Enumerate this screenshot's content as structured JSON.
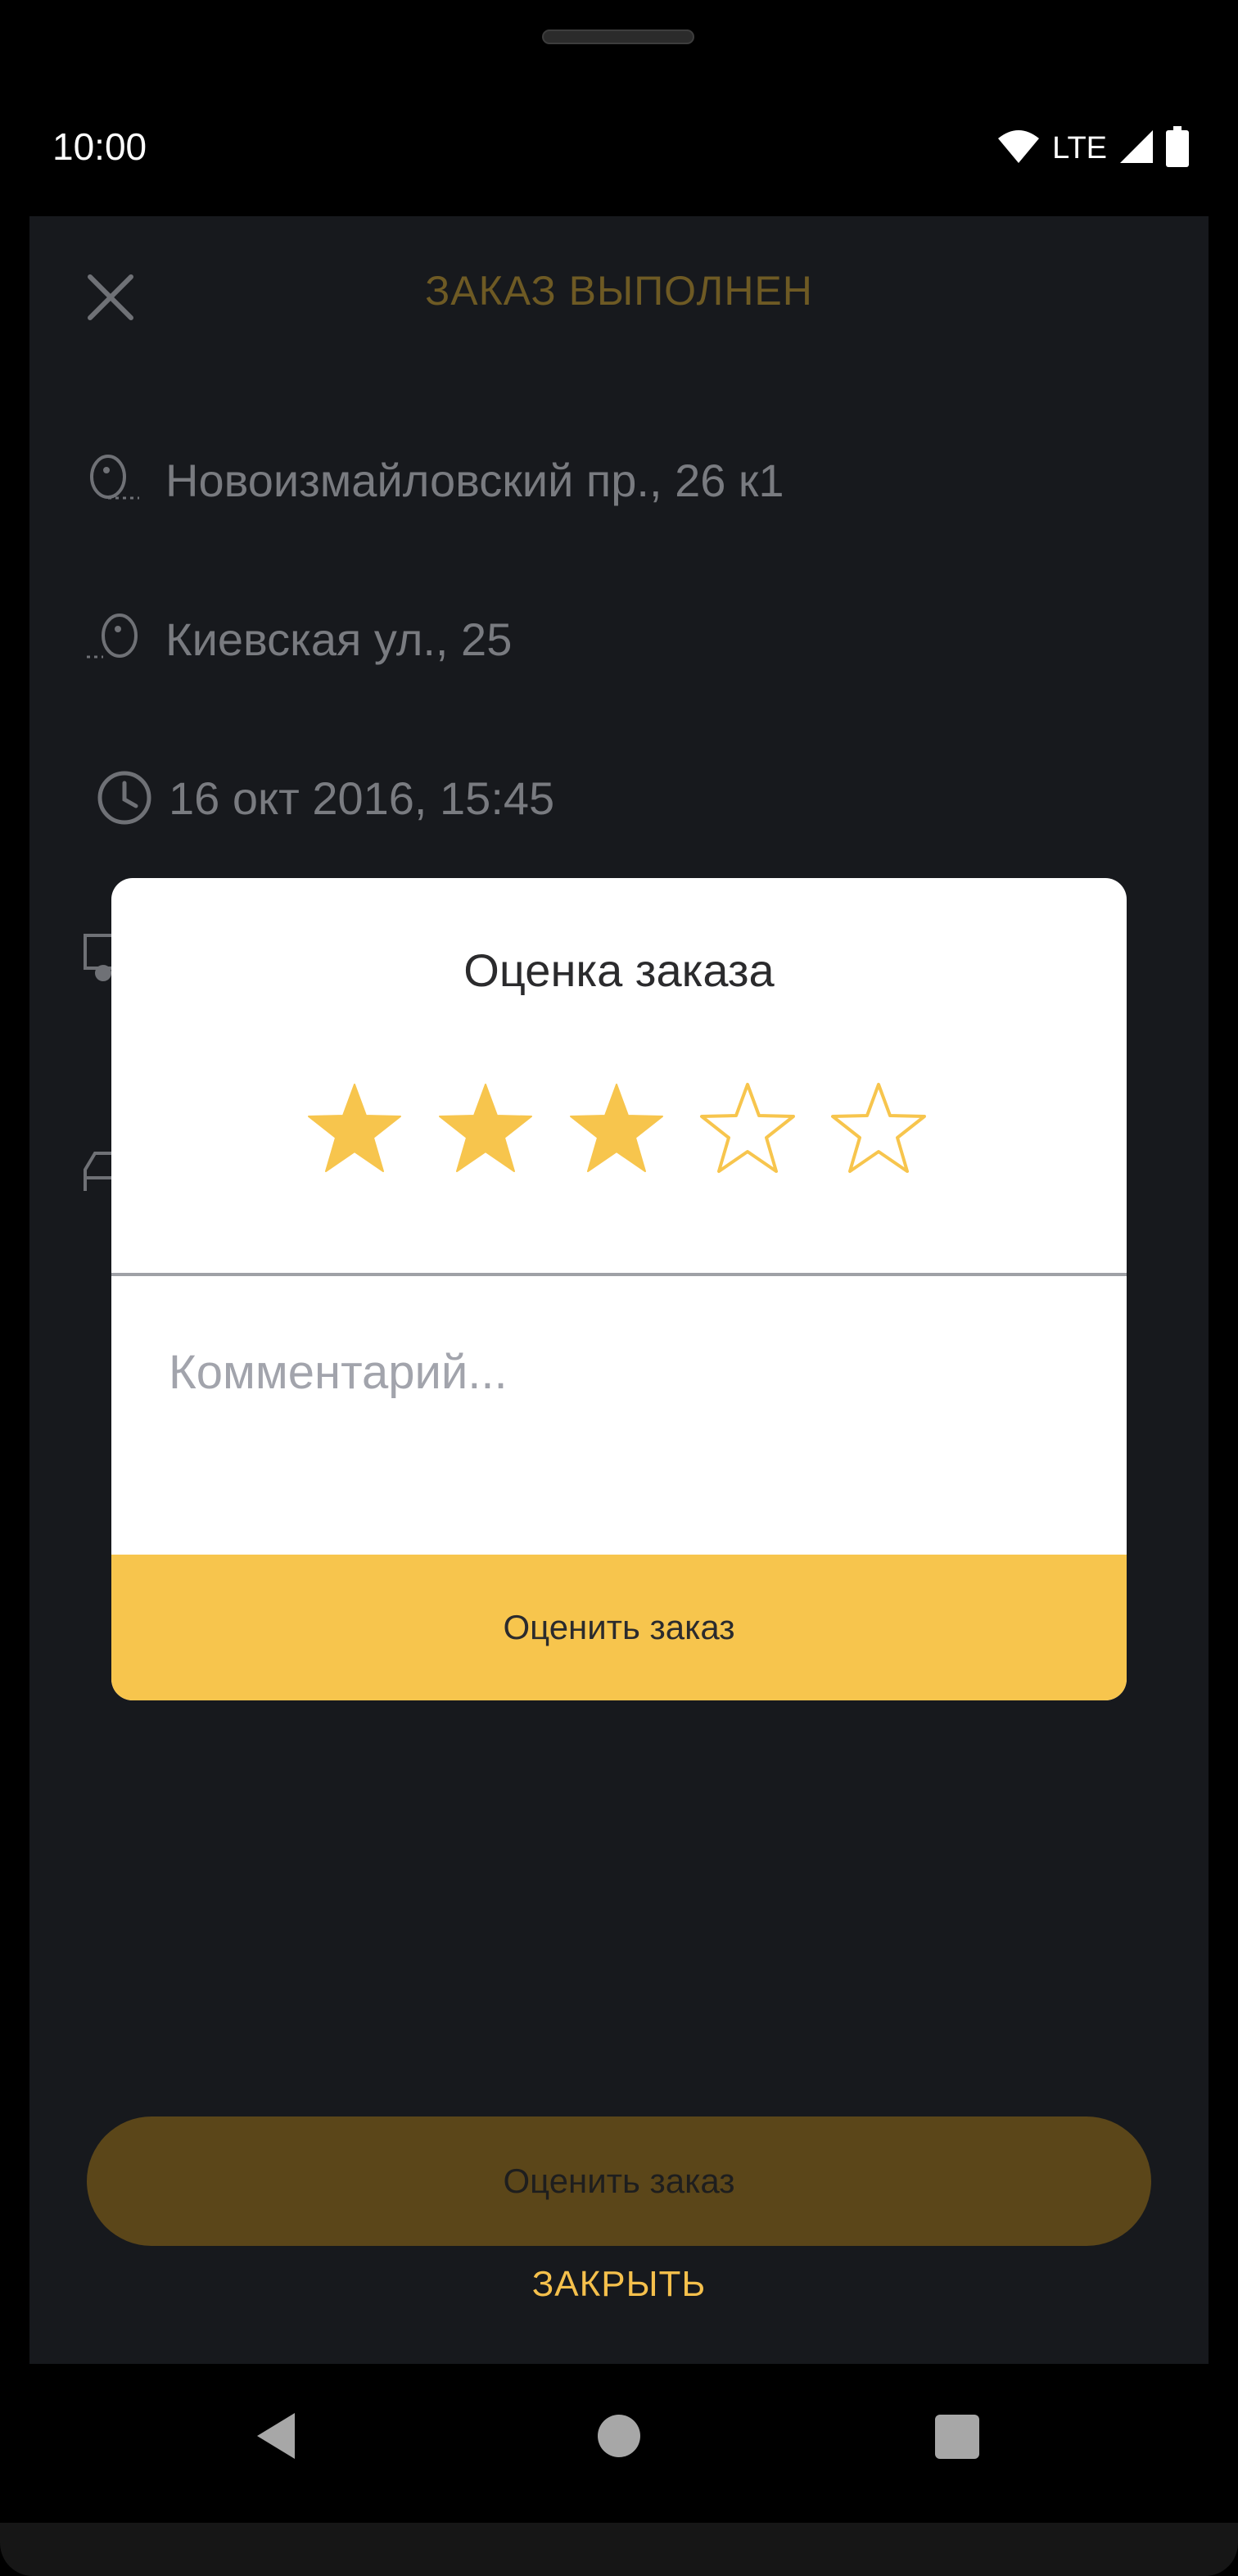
{
  "status_bar": {
    "time": "10:00",
    "network": "LTE",
    "icons": [
      "wifi-icon",
      "signal-icon",
      "battery-icon"
    ]
  },
  "order_screen": {
    "title": "ЗАКАЗ ВЫПОЛНЕН",
    "from_address": "Новоизмайловский пр., 26 к1",
    "to_address": "Киевская ул., 25",
    "datetime": "16 окт 2016, 15:45",
    "rate_button": "Оценить заказ",
    "close_link": "ЗАКРЫТЬ"
  },
  "rating_dialog": {
    "title": "Оценка заказа",
    "rating": 3,
    "max_rating": 5,
    "comment_placeholder": "Комментарий...",
    "submit_button": "Оценить заказ"
  },
  "colors": {
    "accent": "#f7c54d",
    "background": "#17191d",
    "dialog": "#ffffff",
    "dim_text": "#797b80"
  }
}
